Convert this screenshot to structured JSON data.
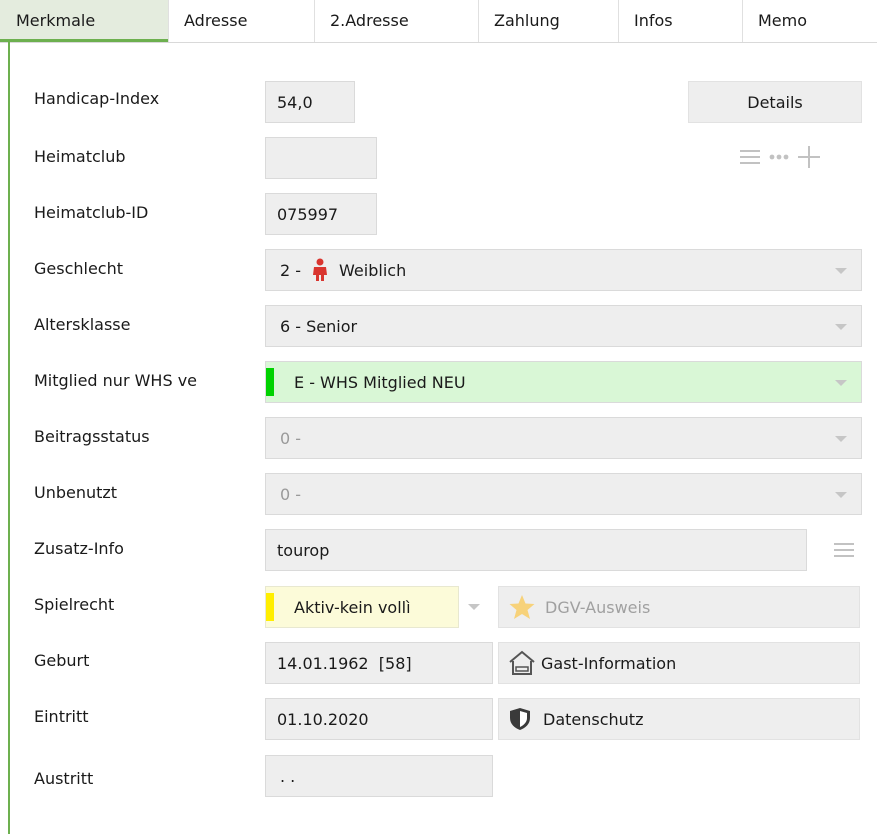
{
  "tabs": [
    {
      "label": "Merkmale",
      "active": true
    },
    {
      "label": "Adresse",
      "active": false
    },
    {
      "label": "2.Adresse",
      "active": false
    },
    {
      "label": "Zahlung",
      "active": false
    },
    {
      "label": "Infos",
      "active": false
    },
    {
      "label": "Memo",
      "active": false
    }
  ],
  "form": {
    "handicap": {
      "label": "Handicap-Index",
      "value": "54,0"
    },
    "heimatclub": {
      "label": "Heimatclub",
      "value": ""
    },
    "heimatclub_id": {
      "label": "Heimatclub-ID",
      "value": "075997"
    },
    "geschlecht": {
      "label": "Geschlecht",
      "code": "2 -",
      "value": "Weiblich"
    },
    "altersklasse": {
      "label": "Altersklasse",
      "value": "6 - Senior"
    },
    "mitglied": {
      "label": "Mitglied nur WHS ve",
      "value": "E - WHS Mitglied NEU",
      "marker_color": "#00d200"
    },
    "beitragsstatus": {
      "label": "Beitragsstatus",
      "value": "0 -"
    },
    "unbenutzt": {
      "label": "Unbenutzt",
      "value": "0 -"
    },
    "zusatz_info": {
      "label": "Zusatz-Info",
      "value": "tourop"
    },
    "spielrecht": {
      "label": "Spielrecht",
      "value": "Aktiv-kein vollì",
      "marker_color": "#ffee00"
    },
    "geburt": {
      "label": "Geburt",
      "value": "14.01.1962  [58]"
    },
    "eintritt": {
      "label": "Eintritt",
      "value": "01.10.2020"
    },
    "austritt": {
      "label": "Austritt",
      "value": ". ."
    }
  },
  "buttons": {
    "details": "Details",
    "dgv_ausweis": "DGV-Ausweis",
    "gast_information": "Gast-Information",
    "datenschutz": "Datenschutz"
  },
  "colors": {
    "accent_green": "#6db04f",
    "female_icon": "#d9352f",
    "star": "#f7d27a"
  }
}
